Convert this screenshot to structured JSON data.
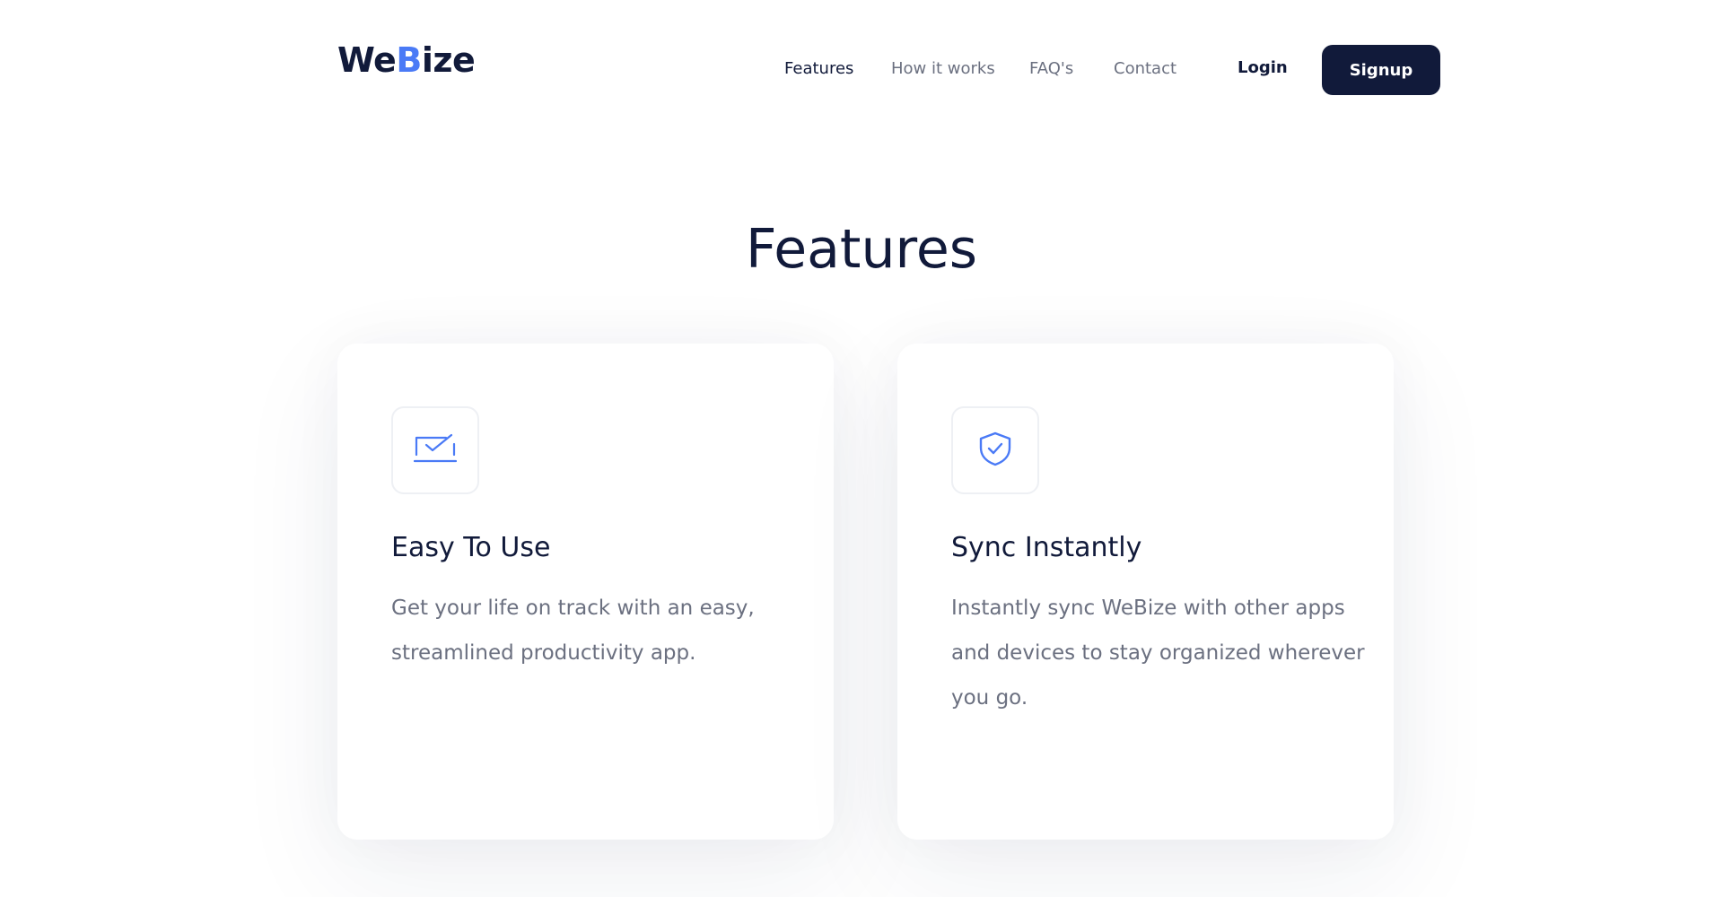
{
  "header": {
    "logo": {
      "part1": "We",
      "part2": "B",
      "part3": "ize"
    },
    "nav": [
      "Features",
      "How it works",
      "FAQ's",
      "Contact"
    ],
    "login_label": "Login",
    "signup_label": "Signup"
  },
  "features": {
    "title": "Features",
    "cards": [
      {
        "icon": "laptop-check-icon",
        "title": "Easy To Use",
        "description": "Get your life on track with an easy, streamlined productivity app."
      },
      {
        "icon": "shield-check-icon",
        "title": "Sync Instantly",
        "description": "Instantly sync WeBize with other apps and devices to stay organized wherever you go."
      }
    ]
  },
  "colors": {
    "brand_dark": "#111a3a",
    "accent_blue": "#4a7af6",
    "muted_text": "#6b7080"
  }
}
